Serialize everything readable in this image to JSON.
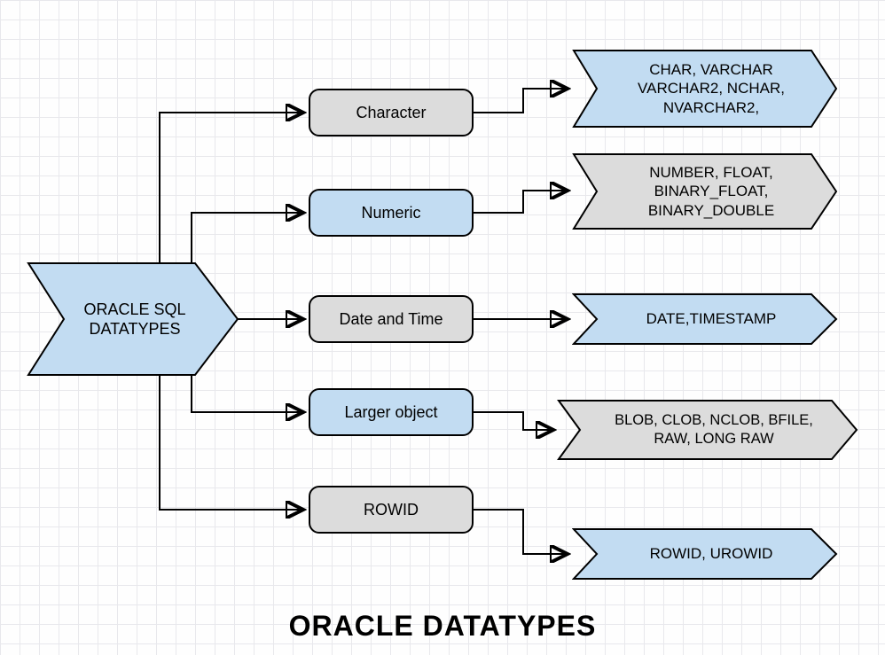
{
  "root": {
    "label": "ORACLE SQL\nDATATYPES"
  },
  "categories": [
    {
      "label": "Character",
      "color": "grey"
    },
    {
      "label": "Numeric",
      "color": "blue"
    },
    {
      "label": "Date and Time",
      "color": "grey"
    },
    {
      "label": "Larger object",
      "color": "blue"
    },
    {
      "label": "ROWID",
      "color": "grey"
    }
  ],
  "leaves": [
    {
      "label": "CHAR, VARCHAR\nVARCHAR2, NCHAR,\nNVARCHAR2,"
    },
    {
      "label": "NUMBER, FLOAT,\nBINARY_FLOAT,\nBINARY_DOUBLE"
    },
    {
      "label": "DATE,TIMESTAMP"
    },
    {
      "label": "BLOB, CLOB, NCLOB, BFILE,\nRAW, LONG RAW"
    },
    {
      "label": "ROWID, UROWID"
    }
  ],
  "title": "ORACLE DATATYPES",
  "colors": {
    "blue": "#c2dcf2",
    "grey": "#dcdcdc"
  }
}
